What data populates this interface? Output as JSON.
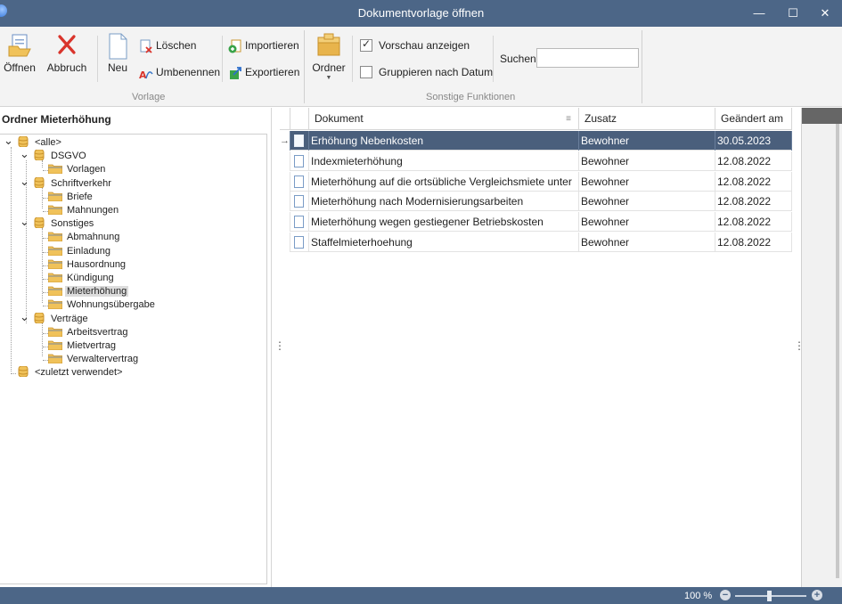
{
  "window": {
    "title": "Dokumentvorlage öffnen",
    "minimize_glyph": "—",
    "maximize_glyph": "☐",
    "close_glyph": "✕"
  },
  "ribbon": {
    "open_label": "Öffnen",
    "cancel_label": "Abbruch",
    "new_label": "Neu",
    "delete_label": "Löschen",
    "rename_label": "Umbenennen",
    "import_label": "Importieren",
    "export_label": "Exportieren",
    "group_vorlage": "Vorlage",
    "folder_label": "Ordner",
    "preview_label": "Vorschau anzeigen",
    "preview_checked": true,
    "group_by_date_label": "Gruppieren nach Datum",
    "group_by_date_checked": false,
    "search_label": "Suchen",
    "search_value": "",
    "group_sonstige": "Sonstige Funktionen"
  },
  "tree": {
    "header": "Ordner Mieterhöhung",
    "nodes": [
      {
        "label": "<alle>",
        "level": 0,
        "expanded": true
      },
      {
        "label": "DSGVO",
        "level": 1,
        "expanded": true
      },
      {
        "label": "Vorlagen",
        "level": 2
      },
      {
        "label": "Schriftverkehr",
        "level": 1,
        "expanded": true
      },
      {
        "label": "Briefe",
        "level": 2
      },
      {
        "label": "Mahnungen",
        "level": 2
      },
      {
        "label": "Sonstiges",
        "level": 1,
        "expanded": true
      },
      {
        "label": "Abmahnung",
        "level": 2
      },
      {
        "label": "Einladung",
        "level": 2
      },
      {
        "label": "Hausordnung",
        "level": 2
      },
      {
        "label": "Kündigung",
        "level": 2
      },
      {
        "label": "Mieterhöhung",
        "level": 2,
        "selected": true
      },
      {
        "label": "Wohnungsübergabe",
        "level": 2
      },
      {
        "label": "Verträge",
        "level": 1,
        "expanded": true
      },
      {
        "label": "Arbeitsvertrag",
        "level": 2
      },
      {
        "label": "Mietvertrag",
        "level": 2
      },
      {
        "label": "Verwaltervertrag",
        "level": 2
      },
      {
        "label": "<zuletzt verwendet>",
        "level": 0
      }
    ]
  },
  "grid": {
    "columns": [
      "Dokument",
      "Zusatz",
      "Geändert am"
    ],
    "rows": [
      {
        "document": "Erhöhung Nebenkosten",
        "zusatz": "Bewohner",
        "changed": "30.05.2023",
        "selected": true
      },
      {
        "document": "Indexmieterhöhung",
        "zusatz": "Bewohner",
        "changed": "12.08.2022"
      },
      {
        "document": "Mieterhöhung auf die ortsübliche Vergleichsmiete unter",
        "zusatz": "Bewohner",
        "changed": "12.08.2022"
      },
      {
        "document": "Mieterhöhung nach Modernisierungsarbeiten",
        "zusatz": "Bewohner",
        "changed": "12.08.2022"
      },
      {
        "document": "Mieterhöhung wegen gestiegener Betriebskosten",
        "zusatz": "Bewohner",
        "changed": "12.08.2022"
      },
      {
        "document": "Staffelmieterhoehung",
        "zusatz": "Bewohner",
        "changed": "12.08.2022"
      }
    ]
  },
  "statusbar": {
    "zoom": "100 %",
    "zoom_minus": "−",
    "zoom_plus": "+"
  },
  "icons": {
    "open": "open-document-icon",
    "cancel": "cancel-x-icon",
    "new": "new-document-icon",
    "delete": "delete-document-icon",
    "rename": "rename-icon",
    "import": "import-icon",
    "export": "export-icon",
    "folder": "folder-box-icon",
    "tree_folder": "folder-icon",
    "tree_db": "database-icon",
    "doc": "document-icon",
    "row_pointer": "row-pointer-icon"
  },
  "colors": {
    "titlebar": "#4c6687",
    "selection": "#4a5f7c",
    "cancel_red": "#d9342b",
    "folder_gold": "#e8b44c"
  }
}
